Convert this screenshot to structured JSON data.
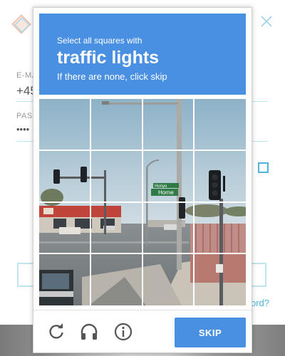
{
  "background_form": {
    "email_label": "E-MA",
    "email_value": "+45",
    "password_label": "PASS",
    "password_value": "••••",
    "forgot_link": "ord?"
  },
  "captcha": {
    "instruction_small": "Select all squares with",
    "instruction_big": "traffic lights",
    "instruction_sub": "If there are none, click skip",
    "street_sign_top": "Honyo",
    "street_sign_bottom": "Horne",
    "skip_label": "SKIP",
    "grid": {
      "rows": 4,
      "cols": 4
    },
    "footer_icons": [
      "reload-icon",
      "audio-icon",
      "info-icon"
    ]
  },
  "colors": {
    "header_blue": "#4a90e2",
    "accent_light_blue": "#4fb3dc"
  }
}
